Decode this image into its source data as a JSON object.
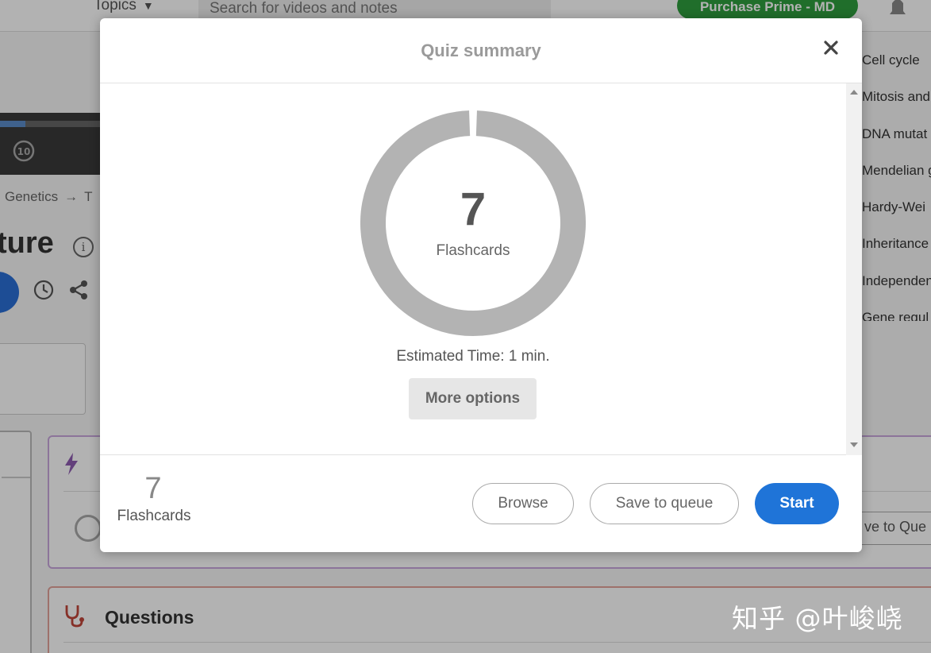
{
  "background": {
    "nav": {
      "topics_label": "Topics",
      "search_placeholder": "Search for videos and notes",
      "purchase_label": "Purchase Prime - MD"
    },
    "breadcrumb": {
      "item": "Genetics",
      "next_fragment": "T"
    },
    "title_fragment": "ture",
    "topic_list": [
      "Cell cycle",
      "Mitosis and",
      "DNA mutat",
      "Mendelian g",
      "Hardy-Wei",
      "Inheritance",
      "Independen",
      "Gene regul"
    ],
    "flashcards_panel": {
      "save_fragment": "ve to Que"
    },
    "questions_panel": {
      "title": "Questions"
    },
    "watermark": "知乎 @叶峻峣"
  },
  "modal": {
    "title": "Quiz summary",
    "ring": {
      "count": "7",
      "label": "Flashcards",
      "fill_fraction": 1.0
    },
    "estimated_time": {
      "label": "Estimated Time:",
      "value": "1 min."
    },
    "more_options_label": "More options",
    "footer": {
      "count": "7",
      "label": "Flashcards",
      "browse_label": "Browse",
      "save_queue_label": "Save to queue",
      "start_label": "Start"
    }
  },
  "colors": {
    "start_button": "#1f74d8",
    "ring": "#b3b3b3",
    "purchase_button": "#2e9e3e"
  },
  "icons": [
    "chevron-down-icon",
    "bell-icon",
    "replay-10-icon",
    "info-icon",
    "clock-icon",
    "share-icon",
    "bolt-icon",
    "stethoscope-icon",
    "close-icon",
    "scroll-up-icon",
    "scroll-down-icon"
  ]
}
